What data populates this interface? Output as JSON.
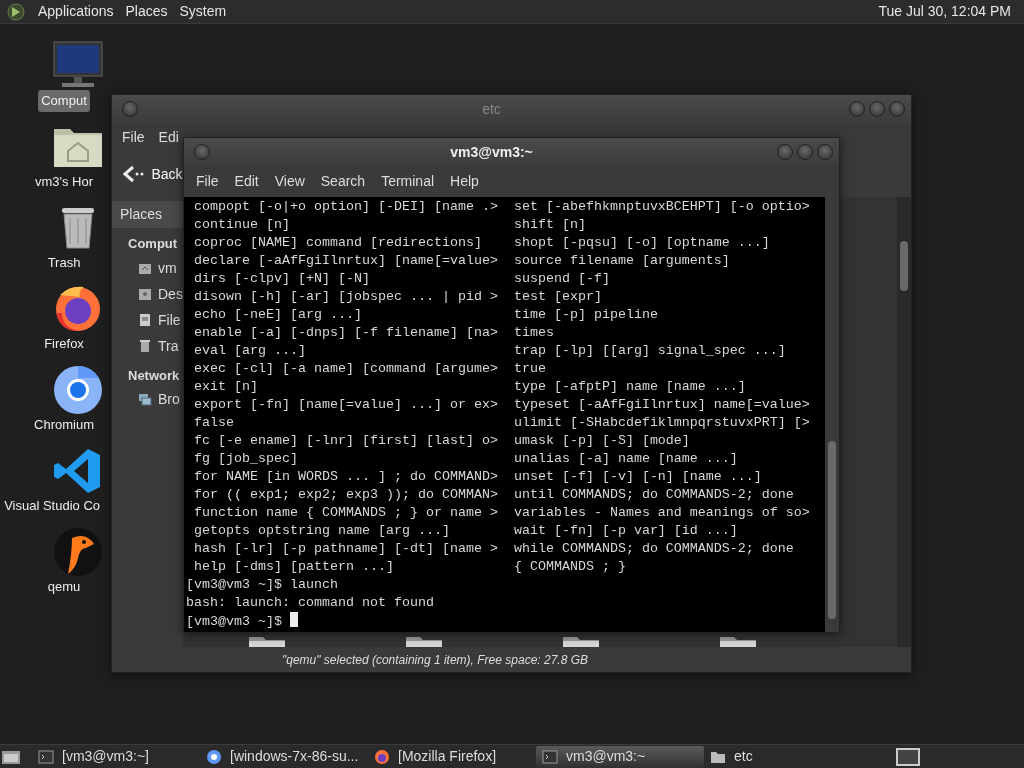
{
  "top_panel": {
    "menus": [
      "Applications",
      "Places",
      "System"
    ],
    "clock": "Tue Jul 30, 12:04 PM"
  },
  "desktop_icons": [
    {
      "label": "Comput",
      "kind": "computer",
      "selected": true
    },
    {
      "label": "vm3's Hor",
      "kind": "home",
      "selected": false
    },
    {
      "label": "Trash",
      "kind": "trash",
      "selected": false
    },
    {
      "label": "Firefox",
      "kind": "firefox",
      "selected": false
    },
    {
      "label": "Chromium",
      "kind": "chromium",
      "selected": false
    },
    {
      "label": "Visual Studio Co",
      "kind": "vscode",
      "selected": false
    },
    {
      "label": "qemu",
      "kind": "qemu",
      "selected": false
    }
  ],
  "file_manager": {
    "title": "etc",
    "menu": [
      "File",
      "Edi"
    ],
    "back_label": "Back",
    "sidebar_header": "Places",
    "sections": [
      {
        "title": "Comput",
        "items": [
          {
            "label": "vm",
            "kind": "home"
          },
          {
            "label": "Des",
            "kind": "desktop"
          },
          {
            "label": "File",
            "kind": "drive"
          },
          {
            "label": "Tra",
            "kind": "trash"
          }
        ]
      },
      {
        "title": "Network",
        "items": [
          {
            "label": "Bro",
            "kind": "network"
          }
        ]
      }
    ],
    "status": "\"qemu\" selected (containing 1 item), Free space: 27.8 GB"
  },
  "terminal": {
    "title": "vm3@vm3:~",
    "menu": [
      "File",
      "Edit",
      "View",
      "Search",
      "Terminal",
      "Help"
    ],
    "rows": [
      {
        "left": "compopt [-o|+o option] [-DEI] [name .>",
        "right": "set [-abefhkmnptuvxBCEHPT] [-o optio>"
      },
      {
        "left": "continue [n]",
        "right": "shift [n]"
      },
      {
        "left": "coproc [NAME] command [redirections]",
        "right": "shopt [-pqsu] [-o] [optname ...]"
      },
      {
        "left": "declare [-aAfFgiIlnrtux] [name[=value>",
        "right": "source filename [arguments]"
      },
      {
        "left": "dirs [-clpv] [+N] [-N]",
        "right": "suspend [-f]"
      },
      {
        "left": "disown [-h] [-ar] [jobspec ... | pid >",
        "right": "test [expr]"
      },
      {
        "left": "echo [-neE] [arg ...]",
        "right": "time [-p] pipeline"
      },
      {
        "left": "enable [-a] [-dnps] [-f filename] [na>",
        "right": "times"
      },
      {
        "left": "eval [arg ...]",
        "right": "trap [-lp] [[arg] signal_spec ...]"
      },
      {
        "left": "exec [-cl] [-a name] [command [argume>",
        "right": "true"
      },
      {
        "left": "exit [n]",
        "right": "type [-afptP] name [name ...]"
      },
      {
        "left": "export [-fn] [name[=value] ...] or ex>",
        "right": "typeset [-aAfFgiIlnrtux] name[=value>"
      },
      {
        "left": "false",
        "right": "ulimit [-SHabcdefiklmnpqrstuvxPRT] [>"
      },
      {
        "left": "fc [-e ename] [-lnr] [first] [last] o>",
        "right": "umask [-p] [-S] [mode]"
      },
      {
        "left": "fg [job_spec]",
        "right": "unalias [-a] name [name ...]"
      },
      {
        "left": "for NAME [in WORDS ... ] ; do COMMAND>",
        "right": "unset [-f] [-v] [-n] [name ...]"
      },
      {
        "left": "for (( exp1; exp2; exp3 )); do COMMAN>",
        "right": "until COMMANDS; do COMMANDS-2; done"
      },
      {
        "left": "function name { COMMANDS ; } or name >",
        "right": "variables - Names and meanings of so>"
      },
      {
        "left": "getopts optstring name [arg ...]",
        "right": "wait [-fn] [-p var] [id ...]"
      },
      {
        "left": "hash [-lr] [-p pathname] [-dt] [name >",
        "right": "while COMMANDS; do COMMANDS-2; done"
      },
      {
        "left": "help [-dms] [pattern ...]",
        "right": "{ COMMANDS ; }"
      }
    ],
    "lines": [
      "[vm3@vm3 ~]$ launch",
      "bash: launch: command not found",
      "[vm3@vm3 ~]$"
    ],
    "cursor_visible": true
  },
  "taskbar": {
    "tasks": [
      {
        "label": "[vm3@vm3:~]",
        "kind": "terminal",
        "selected": false
      },
      {
        "label": "[windows-7x-86-su...",
        "kind": "chromium",
        "selected": false
      },
      {
        "label": "[Mozilla Firefox]",
        "kind": "firefox",
        "selected": false
      },
      {
        "label": "vm3@vm3:~",
        "kind": "terminal",
        "selected": true
      },
      {
        "label": "etc",
        "kind": "folder",
        "selected": false
      }
    ]
  }
}
